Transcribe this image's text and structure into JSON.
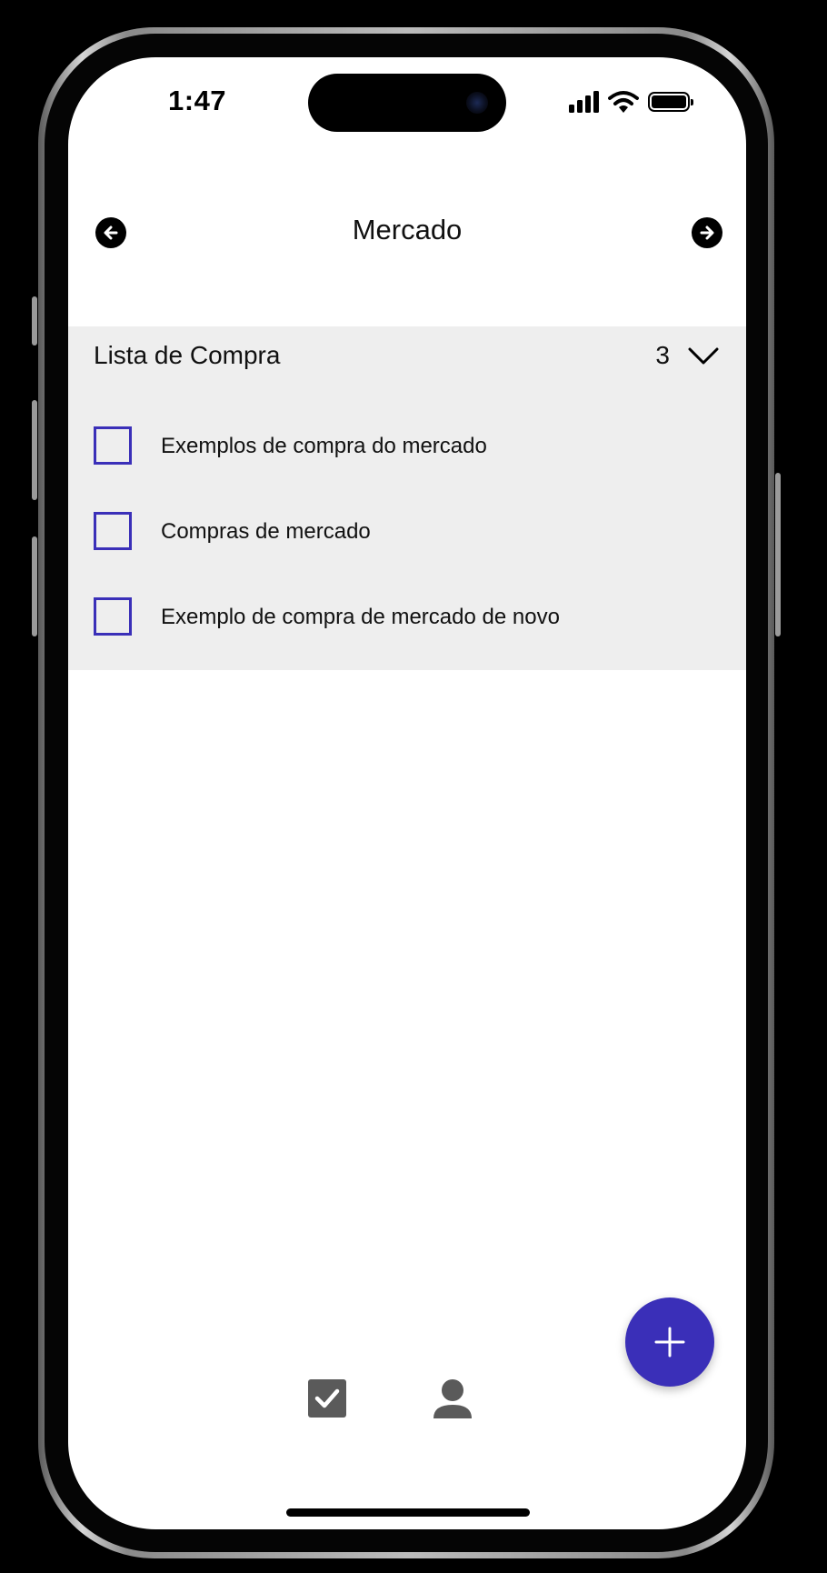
{
  "status_bar": {
    "time": "1:47",
    "icons": [
      "signal-icon",
      "wifi-icon",
      "battery-icon"
    ]
  },
  "header": {
    "title": "Mercado",
    "back_icon": "arrow-left-circle-icon",
    "forward_icon": "arrow-right-circle-icon"
  },
  "list": {
    "title": "Lista de Compra",
    "count": "3",
    "expand_icon": "chevron-down-icon",
    "items": [
      {
        "label": "Exemplos de compra do mercado",
        "checked": false
      },
      {
        "label": "Compras de mercado",
        "checked": false
      },
      {
        "label": "Exemplo de compra de mercado de novo",
        "checked": false
      }
    ]
  },
  "fab": {
    "icon": "plus-icon"
  },
  "bottom_nav": {
    "tabs": [
      {
        "icon": "checkbox-checked-icon",
        "active": true
      },
      {
        "icon": "user-icon",
        "active": false
      }
    ]
  },
  "colors": {
    "accent": "#3a2fb8",
    "section_bg": "#eeeeee",
    "nav_icon": "#5a5a5a",
    "screen_bg": "#ffffff"
  }
}
